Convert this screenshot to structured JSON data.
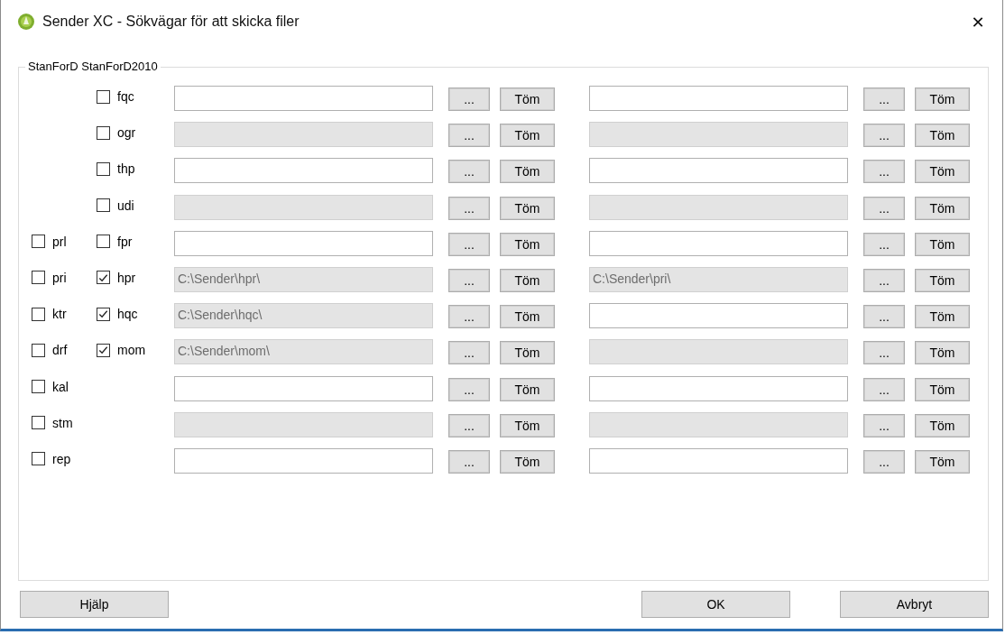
{
  "window": {
    "title": "Sender XC - Sökvägar för att skicka filer",
    "close": "✕"
  },
  "group": {
    "title": "StanForD StanForD2010"
  },
  "rows": [
    {
      "option_2": {
        "label": "fqc",
        "checked": false
      },
      "path_1": {
        "disabled": false
      },
      "browse_1": "...",
      "clear_1": "Töm",
      "path_2": {
        "disabled": false
      },
      "browse_2": "...",
      "clear_2": "Töm"
    },
    {
      "option_2": {
        "label": "ogr",
        "checked": false
      },
      "path_1": {
        "disabled": true
      },
      "browse_1": "...",
      "clear_1": "Töm",
      "path_2": {
        "disabled": true
      },
      "browse_2": "...",
      "clear_2": "Töm"
    },
    {
      "option_2": {
        "label": "thp",
        "checked": false
      },
      "path_1": {
        "disabled": false
      },
      "browse_1": "...",
      "clear_1": "Töm",
      "path_2": {
        "disabled": false
      },
      "browse_2": "...",
      "clear_2": "Töm"
    },
    {
      "option_2": {
        "label": "udi",
        "checked": false
      },
      "path_1": {
        "disabled": true
      },
      "browse_1": "...",
      "clear_1": "Töm",
      "path_2": {
        "disabled": true
      },
      "browse_2": "...",
      "clear_2": "Töm"
    },
    {
      "option_1": {
        "label": "prl",
        "checked": false
      },
      "option_2": {
        "label": "fpr",
        "checked": false
      },
      "path_1": {
        "disabled": false
      },
      "browse_1": "...",
      "clear_1": "Töm",
      "path_2": {
        "disabled": false
      },
      "browse_2": "...",
      "clear_2": "Töm"
    },
    {
      "option_1": {
        "label": "pri",
        "checked": false
      },
      "option_2": {
        "label": "hpr",
        "checked": true
      },
      "path_1": {
        "value": "C:\\Sender\\hpr\\",
        "disabled": true
      },
      "browse_1": "...",
      "clear_1": "Töm",
      "path_2": {
        "value": "C:\\Sender\\pri\\",
        "disabled": true
      },
      "browse_2": "...",
      "clear_2": "Töm"
    },
    {
      "option_1": {
        "label": "ktr",
        "checked": false
      },
      "option_2": {
        "label": "hqc",
        "checked": true
      },
      "path_1": {
        "value": "C:\\Sender\\hqc\\",
        "disabled": true
      },
      "browse_1": "...",
      "clear_1": "Töm",
      "path_2": {
        "disabled": false
      },
      "browse_2": "...",
      "clear_2": "Töm"
    },
    {
      "option_1": {
        "label": "drf",
        "checked": false
      },
      "option_2": {
        "label": "mom",
        "checked": true
      },
      "path_1": {
        "value": "C:\\Sender\\mom\\",
        "disabled": true
      },
      "browse_1": "...",
      "clear_1": "Töm",
      "path_2": {
        "disabled": true
      },
      "browse_2": "...",
      "clear_2": "Töm"
    },
    {
      "option_1": {
        "label": "kal",
        "checked": false
      },
      "path_1": {
        "disabled": false
      },
      "browse_1": "...",
      "clear_1": "Töm",
      "path_2": {
        "disabled": false
      },
      "browse_2": "...",
      "clear_2": "Töm"
    },
    {
      "option_1": {
        "label": "stm",
        "checked": false
      },
      "path_1": {
        "disabled": true
      },
      "browse_1": "...",
      "clear_1": "Töm",
      "path_2": {
        "disabled": true
      },
      "browse_2": "...",
      "clear_2": "Töm"
    },
    {
      "option_1": {
        "label": "rep",
        "checked": false
      },
      "path_1": {
        "disabled": false
      },
      "browse_1": "...",
      "clear_1": "Töm",
      "path_2": {
        "disabled": false
      },
      "browse_2": "...",
      "clear_2": "Töm"
    }
  ],
  "buttons": {
    "help": "Hjälp",
    "ok": "OK",
    "cancel": "Avbryt"
  }
}
